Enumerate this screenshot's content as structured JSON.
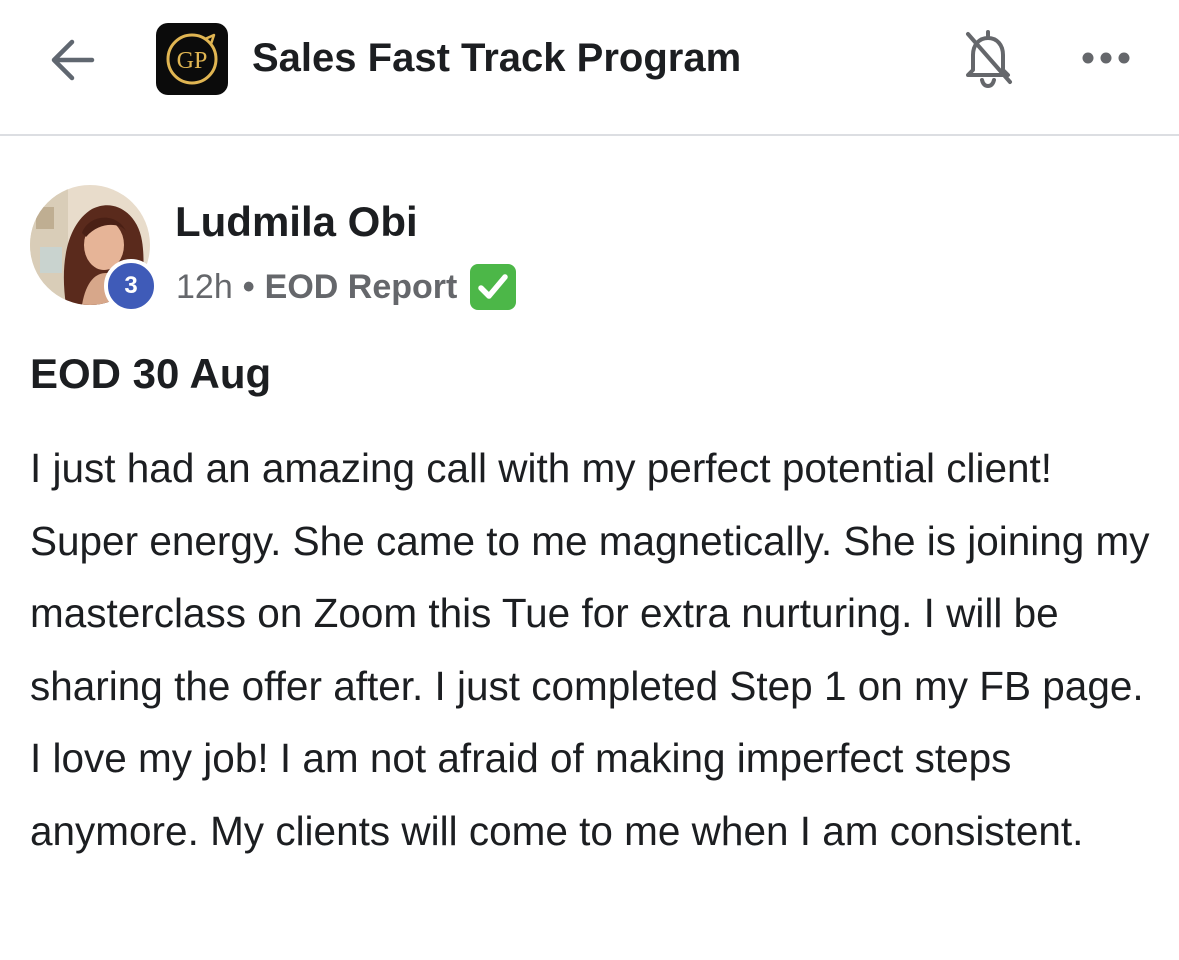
{
  "header": {
    "title": "Sales Fast Track Program",
    "back_icon": "arrow-left-icon",
    "logo_text": "GP",
    "bell_icon": "bell-off-icon",
    "more_icon": "more-horizontal-icon",
    "accent_logo_color": "#e0b552"
  },
  "post": {
    "author": "Ludmila Obi",
    "level": "3",
    "level_color": "#3f5bb8",
    "time": "12h",
    "separator": "•",
    "category": "EOD Report",
    "category_icon": "check-mark-button-icon",
    "title": "EOD 30 Aug",
    "body": "I just had an amazing call with my perfect potential client! Super energy. She came to me magnetically. She is joining my masterclass on Zoom this Tue for extra nurturing. I will be sharing the offer after. I just completed Step 1 on my FB page. I love my job! I am not afraid of making imperfect steps anymore. My clients will come to me when I am consistent."
  }
}
